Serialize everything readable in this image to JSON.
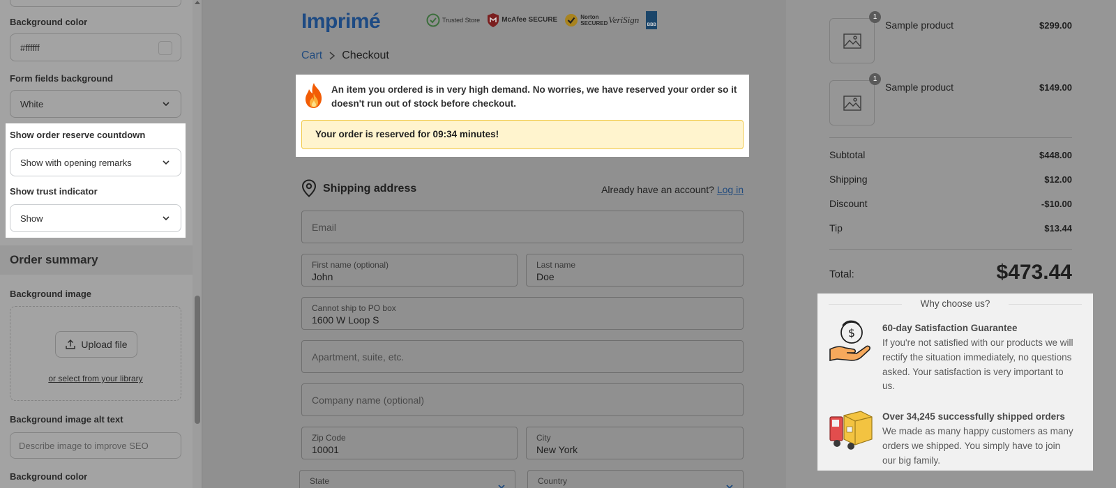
{
  "sidebar": {
    "background_color_label": "Background color",
    "background_color_value": "#ffffff",
    "form_fields_bg_label": "Form fields background",
    "form_fields_bg_value": "White",
    "order_reserve_label": "Show order reserve countdown",
    "order_reserve_value": "Show with opening remarks",
    "trust_indicator_label": "Show trust indicator",
    "trust_indicator_value": "Show",
    "order_summary_title": "Order summary",
    "background_image_label": "Background image",
    "upload_button": "Upload file",
    "library_link": "or select from your library",
    "alt_text_label": "Background image alt text",
    "alt_text_placeholder": "Describe image to improve SEO",
    "background_color_label_2": "Background color"
  },
  "header": {
    "logo": "Imprimé",
    "badges": [
      "Trusted Store",
      "McAfee SECURE",
      "Norton SECURED",
      "VeriSign",
      "BBB"
    ]
  },
  "breadcrumb": {
    "cart": "Cart",
    "current": "Checkout"
  },
  "demand": {
    "text": "An item you ordered is in very high demand. No worries, we have reserved your order so it doesn't run out of stock before checkout.",
    "reserve": "Your order is reserved for 09:34 minutes!"
  },
  "shipping": {
    "title": "Shipping address",
    "account_text": "Already have an account?",
    "login_link": "Log in",
    "email_placeholder": "Email",
    "first_name_label": "First name (optional)",
    "first_name_value": "John",
    "last_name_label": "Last name",
    "last_name_value": "Doe",
    "address_label": "Cannot ship to PO box",
    "address_value": "1600 W Loop S",
    "apartment_placeholder": "Apartment, suite, etc.",
    "company_placeholder": "Company name (optional)",
    "zip_label": "Zip Code",
    "zip_value": "10001",
    "city_label": "City",
    "city_value": "New York",
    "state_label": "State",
    "country_label": "Country"
  },
  "summary": {
    "products": [
      {
        "name": "Sample product",
        "price": "$299.00",
        "qty": "1"
      },
      {
        "name": "Sample product",
        "price": "$149.00",
        "qty": "1"
      }
    ],
    "subtotal_label": "Subtotal",
    "subtotal": "$448.00",
    "shipping_label": "Shipping",
    "shipping": "$12.00",
    "discount_label": "Discount",
    "discount": "-$10.00",
    "tip_label": "Tip",
    "tip": "$13.44",
    "total_label": "Total:",
    "total": "$473.44"
  },
  "why": {
    "title": "Why choose us?",
    "items": [
      {
        "heading": "60-day Satisfaction Guarantee",
        "text": "If you're not satisfied with our products we will rectify the situation immediately, no questions asked. Your satisfaction is very important to us."
      },
      {
        "heading": "Over 34,245 successfully shipped orders",
        "text": "We made as many happy customers as many orders we shipped. You simply have to join our big family."
      }
    ]
  },
  "colors": {
    "accent_link": "#214b7e",
    "logo": "#1d4a83",
    "reserve_bg": "#fff4ce",
    "reserve_border": "#f1c94a"
  }
}
